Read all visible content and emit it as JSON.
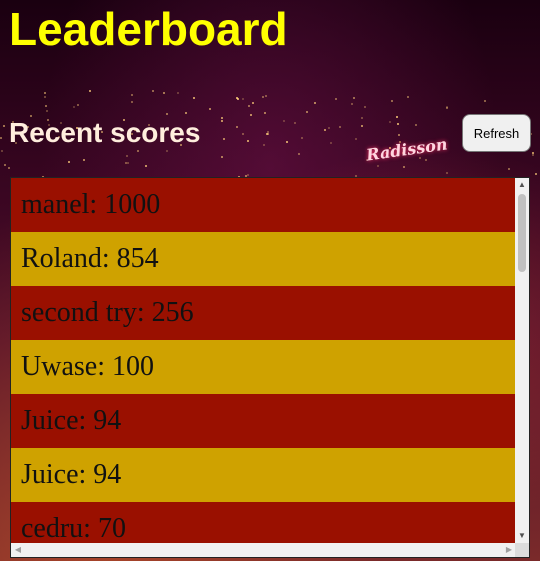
{
  "page": {
    "title": "Leaderboard"
  },
  "scores": {
    "heading": "Recent scores",
    "refresh_label": "Refresh",
    "items": [
      {
        "text": "manel: 1000"
      },
      {
        "text": "Roland: 854"
      },
      {
        "text": "second try: 256"
      },
      {
        "text": "Uwase: 100"
      },
      {
        "text": "Juice: 94"
      },
      {
        "text": "Juice: 94"
      },
      {
        "text": "cedru: 70"
      }
    ]
  },
  "background": {
    "sign_text": "Radisson"
  },
  "colors": {
    "title": "#ffff00",
    "row_odd": "#9a1000",
    "row_even": "#cfa200"
  },
  "icons": {
    "scroll_up": "▲",
    "scroll_down": "▼",
    "scroll_left": "◀",
    "scroll_right": "▶"
  }
}
